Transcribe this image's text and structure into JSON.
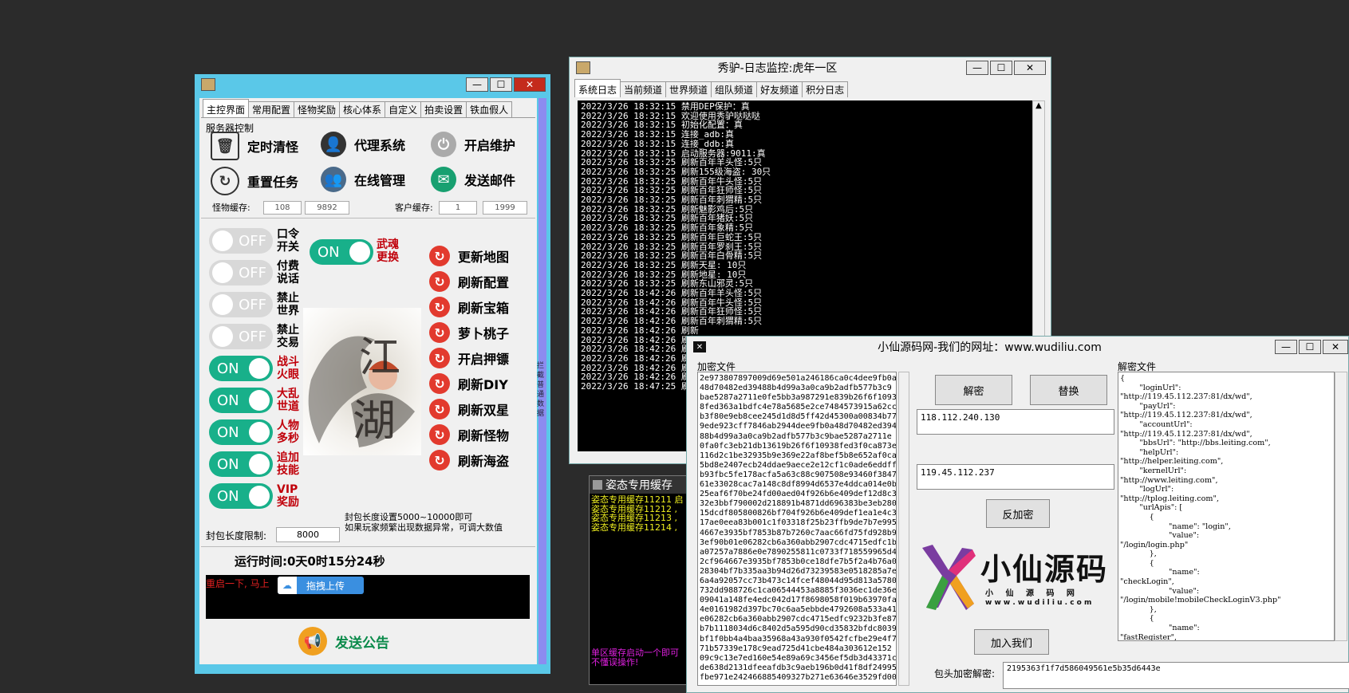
{
  "main_window": {
    "tabs": [
      "主控界面",
      "常用配置",
      "怪物奖励",
      "核心体系",
      "自定义",
      "拍卖设置",
      "铁血假人"
    ],
    "server_control_label": "服务器控制",
    "big_buttons": [
      {
        "label": "定时清怪",
        "icon": "trash-icon"
      },
      {
        "label": "代理系统",
        "icon": "agent-icon"
      },
      {
        "label": "开启维护",
        "icon": "power-icon"
      },
      {
        "label": "重置任务",
        "icon": "reset-icon"
      },
      {
        "label": "在线管理",
        "icon": "users-icon"
      },
      {
        "label": "发送邮件",
        "icon": "mail-icon"
      }
    ],
    "monster_cache_label": "怪物缓存:",
    "monster_cache_values": [
      "108",
      "9892"
    ],
    "client_cache_label": "客户缓存:",
    "client_cache_values": [
      "1",
      "1999"
    ],
    "toggles_left": [
      {
        "state": "OFF",
        "label": "口令开关"
      },
      {
        "state": "OFF",
        "label": "付费说话"
      },
      {
        "state": "OFF",
        "label": "禁止世界"
      },
      {
        "state": "OFF",
        "label": "禁止交易"
      },
      {
        "state": "ON",
        "label": "战斗火眼"
      },
      {
        "state": "ON",
        "label": "大乱世道"
      },
      {
        "state": "ON",
        "label": "人物多秒"
      },
      {
        "state": "ON",
        "label": "追加技能"
      },
      {
        "state": "ON",
        "label": "VIP奖励"
      }
    ],
    "toggle_top": {
      "state": "ON",
      "label": "武魂更换"
    },
    "refresh_buttons": [
      "更新地图",
      "刷新配置",
      "刷新宝箱",
      "萝卜桃子",
      "开启押镖",
      "刷新DIY",
      "刷新双星",
      "刷新怪物",
      "刷新海盗"
    ],
    "packet_note_line1": "封包长度设置5000~10000即可",
    "packet_note_line2": "如果玩家频繁出现数据异常，可调大数值",
    "packet_limit_label": "封包长度限制:",
    "packet_limit_value": "8000",
    "runtime": "运行时间:0天0时15分24秒",
    "notice_text": "重启一下, 马上",
    "upload_label": "拖拽上传",
    "send_notice_label": "发送公告",
    "side_vertical_text": "拦截 普通 数据",
    "colors": {
      "frame": "#5ac8e8",
      "on": "#18b08a",
      "off": "#d8d8d8",
      "red_label": "#c0000a"
    }
  },
  "log_window": {
    "title": "秀驴-日志监控:虎年一区",
    "tabs": [
      "系统日志",
      "当前频道",
      "世界频道",
      "组队频道",
      "好友频道",
      "积分日志"
    ],
    "lines": [
      "2022/3/26 18:32:15 禁用DEP保护：真",
      "2022/3/26 18:32:15 欢迎使用秀驴哒哒哒",
      "2022/3/26 18:32:15 初始化配置：真",
      "2022/3/26 18:32:15 连接_adb:真",
      "2022/3/26 18:32:15 连接_ddb:真",
      "2022/3/26 18:32:15 启动服务器:9011:真",
      "2022/3/26 18:32:25 刷新百年羊头怪:5只",
      "2022/3/26 18:32:25 刷新155级海盗: 30只",
      "2022/3/26 18:32:25 刷新百年牛头怪:5只",
      "2022/3/26 18:32:25 刷新百年狂师怪:5只",
      "2022/3/26 18:32:25 刷新百年刺猬精:5只",
      "2022/3/26 18:32:25 刷新魅影鸡后:5只",
      "2022/3/26 18:32:25 刷新百年猪妖:5只",
      "2022/3/26 18:32:25 刷新百年象精:5只",
      "2022/3/26 18:32:25 刷新百年巨蛇王:5只",
      "2022/3/26 18:32:25 刷新百年罗刹王:5只",
      "2022/3/26 18:32:25 刷新百年白骨精:5只",
      "2022/3/26 18:32:25 刷新天星: 10只",
      "2022/3/26 18:32:25 刷新地星: 10只",
      "2022/3/26 18:32:25 刷新东山邪灵:5只",
      "2022/3/26 18:42:26 刷新百年羊头怪:5只",
      "2022/3/26 18:42:26 刷新百年牛头怪:5只",
      "2022/3/26 18:42:26 刷新百年狂师怪:5只",
      "2022/3/26 18:42:26 刷新百年刺猬精:5只",
      "2022/3/26 18:42:26 刷新",
      "2022/3/26 18:42:26 刷新",
      "2022/3/26 18:42:26 刷新",
      "2022/3/26 18:42:26 刷新",
      "2022/3/26 18:42:26 刷新",
      "2022/3/26 18:42:26 刷新",
      "2022/3/26 18:47:25 刷新"
    ]
  },
  "cache_window": {
    "title": "姿态专用缓存",
    "lines": [
      "姿态专用缓存11211 启",
      "姿态专用缓存11212 ,",
      "姿态专用缓存11213 ,",
      "姿态专用缓存11214 ,"
    ],
    "bottom_lines": [
      "单区缓存启动一个即可",
      "不懂误操作!"
    ]
  },
  "decrypt_window": {
    "title": "小仙源码网-我们的网址：www.wudiliu.com",
    "encrypted_label": "加密文件",
    "encrypted_lines": [
      "2e973807897009d69e501a246186ca0c4dee9fb0a",
      "48d70482ed39488b4d99a3a0ca9b2adfb577b3c9",
      "bae5287a2711e0fe5bb3a987291e839b26f6f1093",
      "8fed363a1bdfc4e78a5685e2ce7484573915a62cc",
      "b3f80e9eb8cee245d1d8d5ff42d45300a00834b77",
      "9ede923cff7846ab2944dee9fb0a48d70482ed394",
      "88b4d99a3a0ca9b2adfb577b3c9bae5287a2711e",
      "0fa0fc3eb21db13619b26f6f10938fed3f0ca873e",
      "116d2c1be32935b9e369e22af8bef5b8e652af0ca",
      "5bd8e2407ecb24ddae9aece2e12cf1c0ade6eddff",
      "b93fbc5fe178acfa5a63c88c907508e93460f3847",
      "61e33028cac7a148c8df8994d6537e4ddca014e0b",
      "25eaf6f70be24fd00aed04f926b6e409def12d8c3",
      "32e3bbf790002d218891b4871dd696383be3eb280",
      "15dcdf805800826bf704f926b6e409def1ea1e4c3",
      "17ae0eea83b001c1f03318f25b23ffb9de7b7e995",
      "4667e3935bf7853b87b7260c7aac66fd75fd928b9",
      "3ef90b01e06282cb6a360abb2907cdc4715edfc1b",
      "a07257a7886e0e7890255811c0733f718559965d4",
      "2cf964667e3935bf7853b0ce18dfe7b5f2a4b76a0",
      "28304bf7b335aa3b94d26d73239583e0518285a7e",
      "6a4a92057cc73b473c14fcef48044d95d813a5780",
      "732dd988726c1ca06544453a8885f3036ec1de36e",
      "09041a148fe4edc042d17f8698058f019b63970fa",
      "4e0161982d397bc70c6aa5ebbde4792608a533a41",
      "e06282cb6a360abb2907cdc4715edfc9232b3fe87",
      "b7b1118034d6c8402d5a595d90cd35832bfdc8039",
      "bf1f0bb4a4baa35968a43a930f0542fcfbe29e4f7",
      "71b57339e178c9ead725d41cbe484a303612e152",
      "09c9c13e7ed160e54e89a69c3456ef5db3d43371c",
      "de638d2131dfeeafdb3c9aeb196b0d41f8df24995",
      "fbe971e242466885409327b271e63646e3529fd00"
    ],
    "decrypt_button": "解密",
    "replace_button": "替换",
    "ip_from": "118.112.240.130",
    "ip_to": "119.45.112.237",
    "reencrypt_button": "反加密",
    "join_button": "加入我们",
    "logo_text": "小仙源码",
    "logo_sub": "小 仙 源 码 网",
    "logo_url": "w w w . w u d i l i u . c o m",
    "decrypted_label": "解密文件",
    "decrypted_lines": [
      "{",
      "        \"loginUrl\":",
      "\"http://119.45.112.237:81/dx/wd\",",
      "        \"payUrl\":",
      "\"http://119.45.112.237:81/dx/wd\",",
      "        \"accountUrl\":",
      "\"http://119.45.112.237:81/dx/wd\",",
      "        \"bbsUrl\": \"http://bbs.leiting.com\",",
      "        \"helpUrl\":",
      "\"http://helper.leiting.com\",",
      "        \"kernelUrl\":",
      "\"http://www.leiting.com\",",
      "        \"logUrl\":",
      "\"http://tplog.leiting.com\",",
      "        \"urlApis\": [",
      "            {",
      "                    \"name\": \"login\",",
      "                    \"value\":",
      "\"/login/login.php\"",
      "            },",
      "            {",
      "                    \"name\":",
      "\"checkLogin\",",
      "                    \"value\":",
      "\"/login/mobile!mobileCheckLoginV3.php\"",
      "            },",
      "            {",
      "                    \"name\":",
      "\"fastRegister\","
    ],
    "header_key_label": "包头加密解密:",
    "header_key_value": "2195363f1f7d586049561e5b35d6443e"
  }
}
